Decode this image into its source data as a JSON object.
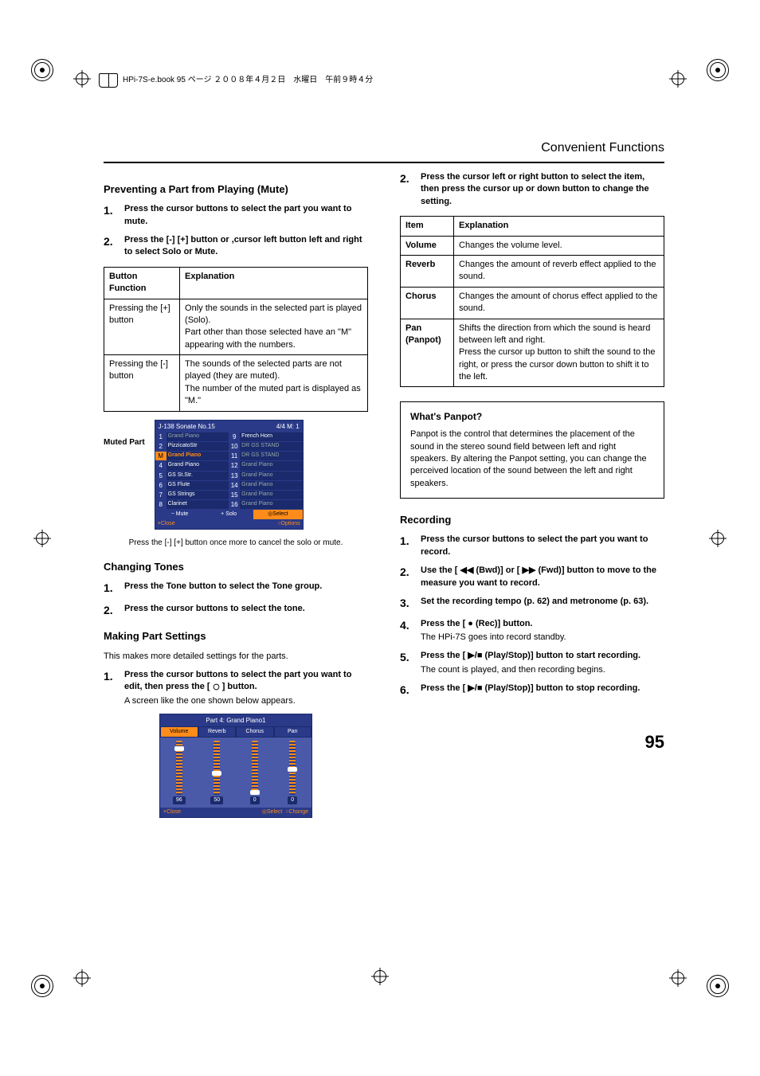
{
  "header": {
    "book_info": "HPi-7S-e.book  95 ページ  ２００８年４月２日　水曜日　午前９時４分"
  },
  "section_title": "Convenient Functions",
  "page_number": "95",
  "left": {
    "mute": {
      "heading": "Preventing a Part from Playing (Mute)",
      "steps": [
        "Press the cursor buttons to select the part you want to mute.",
        "Press the [-] [+] button or ,cursor left button left and right to select Solo or Mute."
      ],
      "table_headers": [
        "Button Function",
        "Explanation"
      ],
      "table_rows": [
        {
          "fn": "Pressing the [+] button",
          "ex": "Only the sounds in the selected part is played (Solo).\nPart other than those selected have an \"M\" appearing with the numbers."
        },
        {
          "fn": "Pressing the [-] button",
          "ex": "The sounds of the selected parts are not played (they are muted).\nThe number of the muted part is displayed as \"M.\""
        }
      ],
      "muted_label": "Muted Part",
      "sc1": {
        "title_left": "J-138 Sonate No.15",
        "title_right": "4/4  M:  1",
        "left_rows": [
          {
            "n": "1",
            "v": "Grand Piano",
            "cls": ""
          },
          {
            "n": "2",
            "v": "PizzicatoStr",
            "cls": "active"
          },
          {
            "n": "M",
            "v": "Grand Piano",
            "cls": "orange",
            "sel": true
          },
          {
            "n": "4",
            "v": "Grand Piano",
            "cls": "active"
          },
          {
            "n": "5",
            "v": "GS St.Str.",
            "cls": "active"
          },
          {
            "n": "6",
            "v": "GS Flute",
            "cls": "active"
          },
          {
            "n": "7",
            "v": "GS Strings",
            "cls": "active"
          },
          {
            "n": "8",
            "v": "Clarinet",
            "cls": "active"
          }
        ],
        "right_rows": [
          {
            "n": "9",
            "v": "French Horn",
            "cls": "active"
          },
          {
            "n": "10",
            "v": "DR GS STAND",
            "cls": ""
          },
          {
            "n": "11",
            "v": "DR GS STAND",
            "cls": ""
          },
          {
            "n": "12",
            "v": "Grand Piano",
            "cls": ""
          },
          {
            "n": "13",
            "v": "Grand Piano",
            "cls": ""
          },
          {
            "n": "14",
            "v": "Grand Piano",
            "cls": ""
          },
          {
            "n": "15",
            "v": "Grand Piano",
            "cls": ""
          },
          {
            "n": "16",
            "v": "Grand Piano",
            "cls": ""
          }
        ],
        "footer1": [
          "− Mute",
          "+ Solo",
          "◎Select"
        ],
        "footer2": [
          "×Close",
          "○Options"
        ]
      },
      "caption": "Press the [-] [+] button once more to cancel the solo or mute."
    },
    "tones": {
      "heading": "Changing Tones",
      "steps": [
        "Press the Tone button to select the Tone group.",
        "Press the cursor buttons to select the tone."
      ]
    },
    "part_settings": {
      "heading": "Making Part Settings",
      "intro": "This makes more detailed settings for the parts.",
      "step1_a": "Press the cursor buttons to select the part you want to edit, then press the [",
      "step1_b": "] button.",
      "step1_sub": "A screen like the one shown below appears.",
      "sc2": {
        "title": "Part 4: Grand Piano1",
        "tabs": [
          "Volume",
          "Reverb",
          "Chorus",
          "Pan"
        ],
        "vals": [
          "96",
          "50",
          "0",
          "0"
        ],
        "footer": [
          "×Close",
          "◎Select",
          "○Change"
        ]
      }
    }
  },
  "right": {
    "step2": "Press the cursor left or right button to select the item, then press the cursor up or down button to change the setting.",
    "table_headers": [
      "Item",
      "Explanation"
    ],
    "table_rows": [
      {
        "i": "Volume",
        "e": "Changes the volume level."
      },
      {
        "i": "Reverb",
        "e": "Changes the amount of reverb effect applied to the sound."
      },
      {
        "i": "Chorus",
        "e": "Changes the amount of chorus effect applied to the sound."
      },
      {
        "i": "Pan (Panpot)",
        "e": "Shifts the direction from which the sound is heard between left and right.\nPress the cursor up button to shift the sound to the right, or press the cursor down button to shift it to the left."
      }
    ],
    "panpot": {
      "heading": "What's Panpot?",
      "body": "Panpot is the control that determines the placement of the sound in the stereo sound field between left and right speakers. By altering the Panpot setting, you can change the perceived location of the sound between the left and right speakers."
    },
    "recording": {
      "heading": "Recording",
      "steps": [
        {
          "t": "Press the cursor buttons to select the part you want to record."
        },
        {
          "t": "Use the [ ◀◀ (Bwd)] or [ ▶▶ (Fwd)] button to move to the measure you want to record."
        },
        {
          "t": "Set the recording tempo (p. 62) and metronome (p. 63)."
        },
        {
          "t": "Press the [ ● (Rec)] button.",
          "sub": "The HPi-7S goes into record standby."
        },
        {
          "t": "Press the [ ▶/■ (Play/Stop)] button to start recording.",
          "sub": "The count is played, and then recording begins."
        },
        {
          "t": "Press the [ ▶/■ (Play/Stop)] button to stop recording."
        }
      ]
    }
  }
}
